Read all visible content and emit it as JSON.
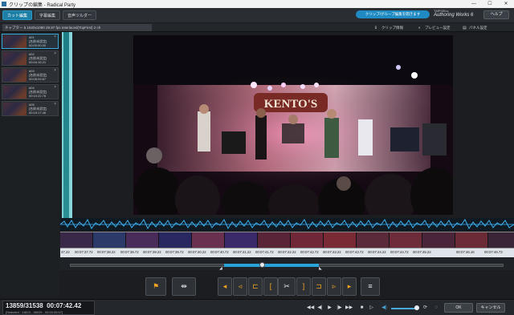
{
  "window": {
    "title": "クリップの編集 - Radical Party",
    "min": "—",
    "max": "☐",
    "close": "✕"
  },
  "toolbar": {
    "tabs": [
      "カット編集",
      "字幕編集",
      "音声ツルダー"
    ],
    "guide_label": "クリップ/グループ編集を開きます",
    "brand_top": "TMPGEnc",
    "brand_name": "Authoring Works 6",
    "help_label": "ヘルプ"
  },
  "infobar": {
    "clip_info": "チャプター 5  1920x1080 29.97 fps  Interlaced(TopFirst)  2 ch",
    "tabs": [
      "クリップ情報",
      "プレビュー設定",
      "パネル設定"
    ]
  },
  "clips": [
    {
      "id": "#01",
      "name": "[名前未設定]",
      "tc": "00:00:00.00"
    },
    {
      "id": "#02",
      "name": "[名前未設定]",
      "tc": "00:04:15.21"
    },
    {
      "id": "#03",
      "name": "[名前未設定]",
      "tc": "00:05:09.87"
    },
    {
      "id": "#04",
      "name": "[名前未設定]",
      "tc": "00:10:22.76"
    },
    {
      "id": "#05",
      "name": "[名前未設定]",
      "tc": "00:15:17.46"
    }
  ],
  "ruler": [
    "37.22",
    "00:07:37.72",
    "00:07:38.22",
    "00:07:38.72",
    "00:07:39.22",
    "00:07:39.72",
    "00:07:40.22",
    "00:07:40.72",
    "00:07:41.22",
    "00:07:41.72",
    "00:07:42.22",
    "00:07:42.72",
    "00:07:43.22",
    "00:07:43.72",
    "00:07:44.22",
    "00:07:44.72",
    "00:07:45.22",
    "00:07:46.16",
    "00:07:46.73",
    "00:07"
  ],
  "status": {
    "frame": "13859/31538",
    "timecode": "00:07:42.42",
    "selected": "[Selected : 11823 - 38029 , 00:53:39.67]"
  },
  "dialog": {
    "ok": "OK",
    "cancel": "キャンセル"
  },
  "icons": {
    "cut-in": "cut-in-icon",
    "cut-out": "cut-out-icon",
    "play": "play-icon",
    "volume": "speaker-icon"
  }
}
